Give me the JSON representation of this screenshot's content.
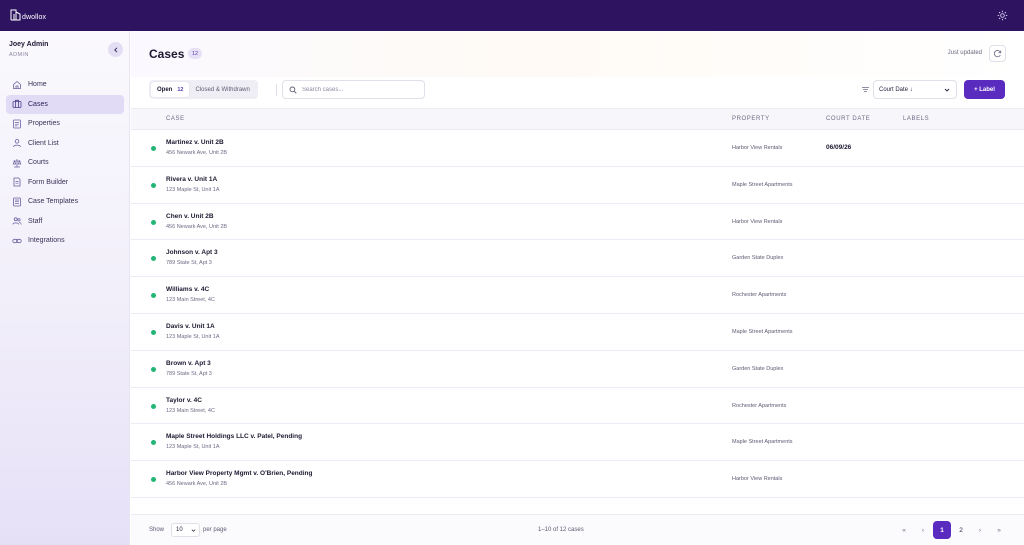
{
  "app": {
    "logo_text": "dwollox"
  },
  "user": {
    "name": "Joey Admin",
    "role": "ADMIN"
  },
  "sidebar": {
    "items": [
      {
        "label": "Home",
        "icon": "home-icon",
        "active": false
      },
      {
        "label": "Cases",
        "icon": "cases-icon",
        "active": true
      },
      {
        "label": "Properties",
        "icon": "properties-icon",
        "active": false
      },
      {
        "label": "Client List",
        "icon": "client-list-icon",
        "active": false
      },
      {
        "label": "Courts",
        "icon": "courts-icon",
        "active": false
      },
      {
        "label": "Form Builder",
        "icon": "form-builder-icon",
        "active": false
      },
      {
        "label": "Case Templates",
        "icon": "case-templates-icon",
        "active": false
      },
      {
        "label": "Staff",
        "icon": "staff-icon",
        "active": false
      },
      {
        "label": "Integrations",
        "icon": "integrations-icon",
        "active": false
      }
    ]
  },
  "header": {
    "title": "Cases",
    "count": "12",
    "updated": "Just updated"
  },
  "toolbar": {
    "tab_open": "Open",
    "tab_open_count": "12",
    "tab_closed": "Closed & Withdrawn",
    "search_placeholder": "Search cases...",
    "sort_value": "Court Date ↓",
    "label_button": "+ Label"
  },
  "table": {
    "columns": {
      "case": "CASE",
      "property": "PROPERTY",
      "court_date": "COURT DATE",
      "labels": "LABELS"
    },
    "rows": [
      {
        "title": "Martinez v. Unit 2B",
        "address": "456 Newark Ave, Unit 2B",
        "property": "Harbor View Rentals",
        "court_date": "06/09/26"
      },
      {
        "title": "Rivera v. Unit 1A",
        "address": "123 Maple St, Unit 1A",
        "property": "Maple Street Apartments",
        "court_date": ""
      },
      {
        "title": "Chen v. Unit 2B",
        "address": "456 Newark Ave, Unit 2B",
        "property": "Harbor View Rentals",
        "court_date": ""
      },
      {
        "title": "Johnson v. Apt 3",
        "address": "789 State St, Apt 3",
        "property": "Garden State Duplex",
        "court_date": ""
      },
      {
        "title": "Williams v. 4C",
        "address": "123 Main Street, 4C",
        "property": "Rochester Apartments",
        "court_date": ""
      },
      {
        "title": "Davis v. Unit 1A",
        "address": "123 Maple St, Unit 1A",
        "property": "Maple Street Apartments",
        "court_date": ""
      },
      {
        "title": "Brown v. Apt 3",
        "address": "789 State St, Apt 3",
        "property": "Garden State Duplex",
        "court_date": ""
      },
      {
        "title": "Taylor v. 4C",
        "address": "123 Main Street, 4C",
        "property": "Rochester Apartments",
        "court_date": ""
      },
      {
        "title": "Maple Street Holdings LLC v. Patel, Pending",
        "address": "123 Maple St, Unit 1A",
        "property": "Maple Street Apartments",
        "court_date": ""
      },
      {
        "title": "Harbor View Property Mgmt v. O'Brien, Pending",
        "address": "456 Newark Ave, Unit 2B",
        "property": "Harbor View Rentals",
        "court_date": ""
      }
    ]
  },
  "footer": {
    "show_label": "Show",
    "per_page_value": "10",
    "per_page_label": "per page",
    "range_text": "1–10 of 12 cases",
    "pager": {
      "first": "«",
      "prev": "‹",
      "page1": "1",
      "page2": "2",
      "next": "›",
      "last": "»"
    }
  },
  "colors": {
    "topbar": "#2e1460",
    "accent": "#5a2bbf",
    "status_dot": "#22b573"
  }
}
